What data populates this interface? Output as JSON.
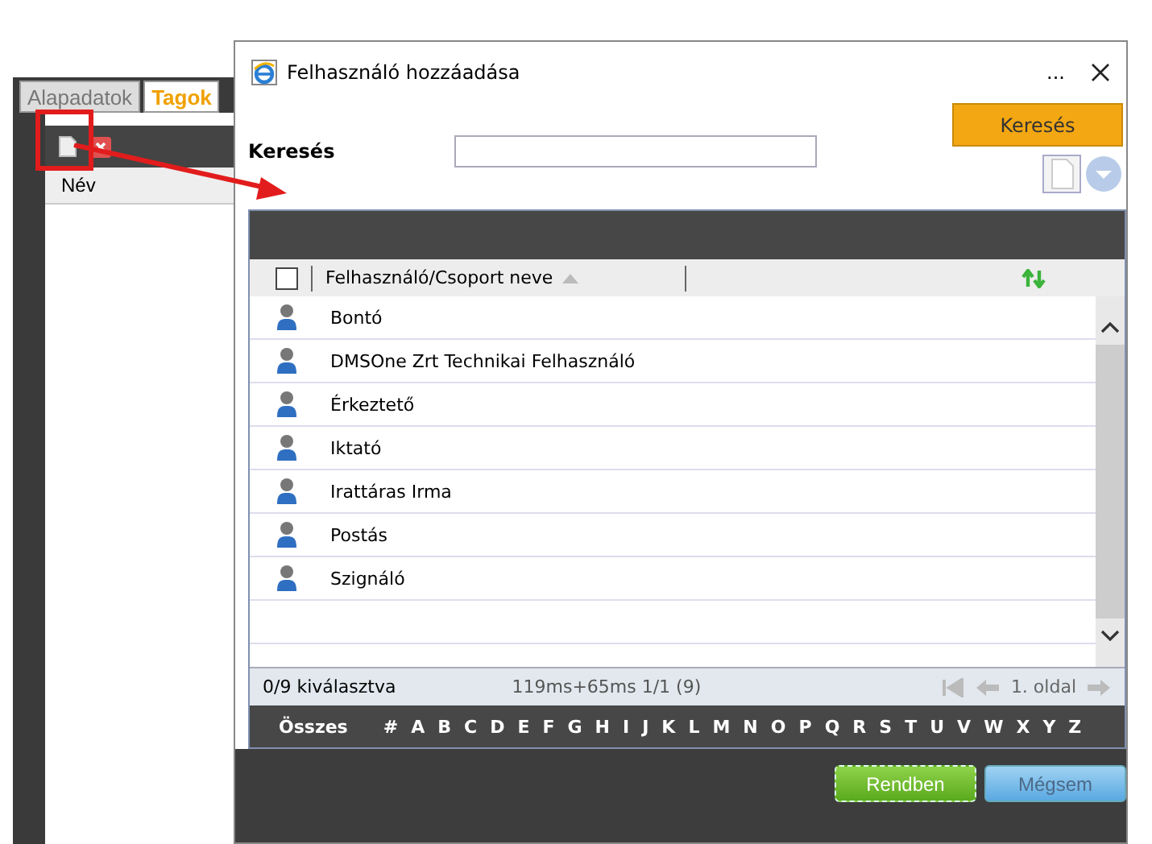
{
  "background_page": {
    "tabs": [
      {
        "label": "Alapadatok",
        "selected": false
      },
      {
        "label": "Tagok",
        "selected": true
      }
    ],
    "table": {
      "columns": [
        "Név"
      ]
    }
  },
  "dialog": {
    "title": "Felhasználó hozzáadása",
    "title_more": "...",
    "search": {
      "label": "Keresés",
      "button": "Keresés"
    },
    "grid": {
      "select_all_checked": false,
      "column": "Felhasználó/Csoport neve",
      "rows": [
        {
          "name": "Bontó"
        },
        {
          "name": "DMSOne Zrt Technikai Felhasználó"
        },
        {
          "name": "Érkeztető"
        },
        {
          "name": "Iktató"
        },
        {
          "name": "Irattáras Irma"
        },
        {
          "name": "Postás"
        },
        {
          "name": "Szignáló"
        }
      ]
    },
    "status": {
      "selection": "0/9 kiválasztva",
      "timing": "119ms+65ms 1/1 (9)",
      "page": "1. oldal"
    },
    "alphabet": {
      "all": "Összes",
      "letters": [
        "#",
        "A",
        "B",
        "C",
        "D",
        "E",
        "F",
        "G",
        "H",
        "I",
        "J",
        "K",
        "L",
        "M",
        "N",
        "O",
        "P",
        "Q",
        "R",
        "S",
        "T",
        "U",
        "V",
        "W",
        "X",
        "Y",
        "Z"
      ]
    },
    "buttons": [
      {
        "label": "Rendben",
        "kind": "primary"
      },
      {
        "label": "Mégsem",
        "kind": "secondary"
      }
    ]
  }
}
